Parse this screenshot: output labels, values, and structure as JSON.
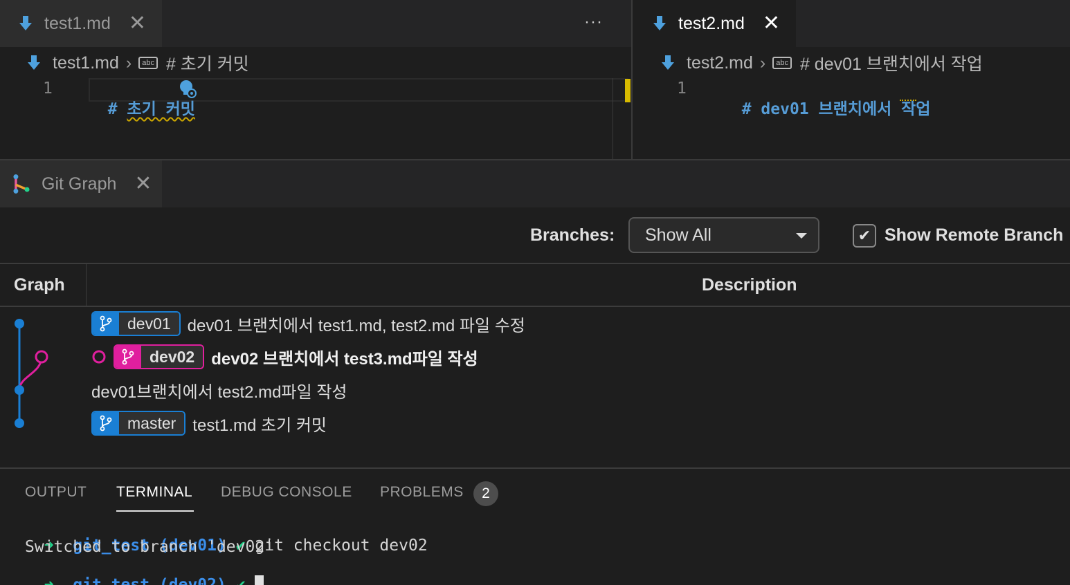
{
  "editor_left": {
    "tab_label": "test1.md",
    "breadcrumb_file": "test1.md",
    "breadcrumb_symbol": "# 초기 커밋",
    "line_number": "1",
    "code_hash": "#",
    "code_text": "초기 커밋",
    "more_actions": "···"
  },
  "editor_right": {
    "tab_label": "test2.md",
    "breadcrumb_file": "test2.md",
    "breadcrumb_symbol": "# dev01 브랜치에서 작업",
    "line_number": "1",
    "code_hash": "#",
    "code_text": "dev01 브랜치에서 작업"
  },
  "git_graph": {
    "tab_label": "Git Graph",
    "branches_label": "Branches:",
    "branches_selected": "Show All",
    "show_remote_label": "Show Remote Branch",
    "show_remote_checked": true,
    "columns": {
      "graph": "Graph",
      "description": "Description"
    },
    "commits": [
      {
        "branch": "dev01",
        "message": "dev01 브랜치에서 test1.md, test2.md 파일 수정",
        "color": "#1a7fd4"
      },
      {
        "branch": "dev02",
        "message": "dev02 브랜치에서 test3.md파일 작성",
        "color": "#e01f9e",
        "head": true
      },
      {
        "branch": "",
        "message": "dev01브랜치에서 test2.md파일 작성",
        "color": "#1a7fd4"
      },
      {
        "branch": "master",
        "message": "test1.md 초기 커밋",
        "color": "#1a7fd4"
      }
    ]
  },
  "panel": {
    "tabs": [
      "OUTPUT",
      "TERMINAL",
      "DEBUG CONSOLE",
      "PROBLEMS"
    ],
    "active_tab": "TERMINAL",
    "problems_count": "2"
  },
  "terminal": {
    "lines": [
      {
        "arrow": "➜",
        "dir": "git_test",
        "branch": "(dev01)",
        "check": "✔",
        "cmd": "git checkout dev02"
      },
      {
        "output": "Switched to branch 'dev02'"
      },
      {
        "arrow": "➜",
        "dir": "git_test",
        "branch": "(dev02)",
        "check": "✔",
        "cmd": ""
      }
    ]
  },
  "colors": {
    "blue_branch": "#1a7fd4",
    "pink_branch": "#e01f9e",
    "prompt_green": "#23d18b",
    "prompt_blue": "#3b8eea"
  }
}
